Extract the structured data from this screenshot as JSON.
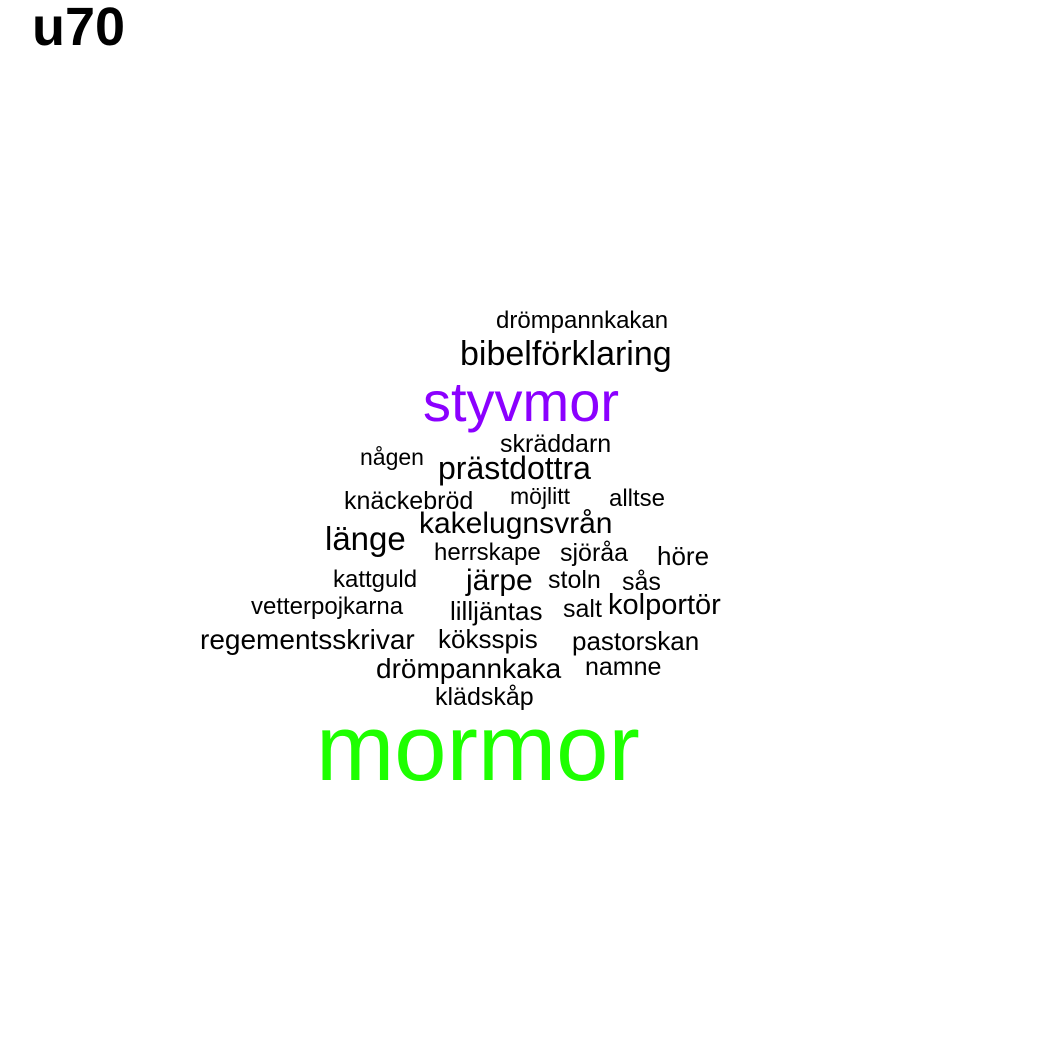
{
  "title": "u70",
  "colors": {
    "default": "#000000",
    "styvmor": "#8b00ff",
    "mormor": "#1eff00"
  },
  "words": [
    {
      "text": "drömpannkakan"
    },
    {
      "text": "bibelförklaring"
    },
    {
      "text": "styvmor",
      "color": "#8b00ff"
    },
    {
      "text": "skräddarn"
    },
    {
      "text": "någen"
    },
    {
      "text": "prästdottra"
    },
    {
      "text": "knäckebröd"
    },
    {
      "text": "möjlitt"
    },
    {
      "text": "alltse"
    },
    {
      "text": "kakelugnsvrån"
    },
    {
      "text": "länge"
    },
    {
      "text": "herrskape"
    },
    {
      "text": "sjöråa"
    },
    {
      "text": "höre"
    },
    {
      "text": "kattguld"
    },
    {
      "text": "järpe"
    },
    {
      "text": "stoln"
    },
    {
      "text": "sås"
    },
    {
      "text": "vetterpojkarna"
    },
    {
      "text": "lilljäntas"
    },
    {
      "text": "salt"
    },
    {
      "text": "kolportör"
    },
    {
      "text": "regementsskrivar"
    },
    {
      "text": "köksspis"
    },
    {
      "text": "pastorskan"
    },
    {
      "text": "drömpannkaka"
    },
    {
      "text": "namne"
    },
    {
      "text": "klädskåp"
    },
    {
      "text": "mormor",
      "color": "#1eff00"
    }
  ]
}
